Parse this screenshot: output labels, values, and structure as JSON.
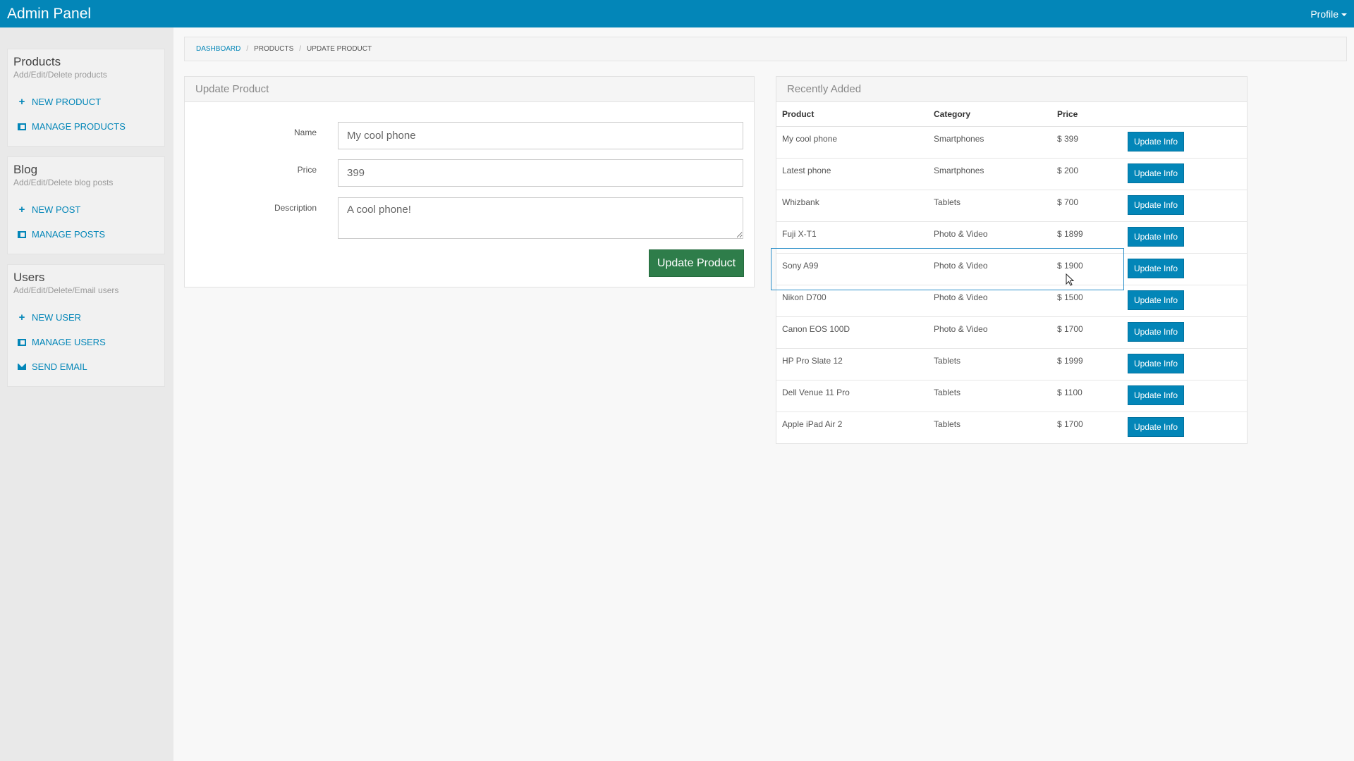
{
  "app": {
    "title": "Admin Panel",
    "profile_label": "Profile"
  },
  "sidebar": {
    "groups": [
      {
        "title": "Products",
        "subtitle": "Add/Edit/Delete products",
        "links": [
          {
            "label": "NEW PRODUCT",
            "icon": "plus-icon"
          },
          {
            "label": "MANAGE PRODUCTS",
            "icon": "list-icon"
          }
        ]
      },
      {
        "title": "Blog",
        "subtitle": "Add/Edit/Delete blog posts",
        "links": [
          {
            "label": "NEW POST",
            "icon": "plus-icon"
          },
          {
            "label": "MANAGE POSTS",
            "icon": "list-icon"
          }
        ]
      },
      {
        "title": "Users",
        "subtitle": "Add/Edit/Delete/Email users",
        "links": [
          {
            "label": "NEW USER",
            "icon": "plus-icon"
          },
          {
            "label": "MANAGE USERS",
            "icon": "list-icon"
          },
          {
            "label": "SEND EMAIL",
            "icon": "envelope-icon"
          }
        ]
      }
    ]
  },
  "breadcrumb": {
    "items": [
      "DASHBOARD",
      "PRODUCTS",
      "UPDATE PRODUCT"
    ],
    "separator": "/"
  },
  "update_form": {
    "title": "Update Product",
    "name_label": "Name",
    "name_value": "My cool phone",
    "price_label": "Price",
    "price_value": "399",
    "description_label": "Description",
    "description_value": "A cool phone!",
    "submit_label": "Update Product"
  },
  "recent": {
    "title": "Recently Added",
    "columns": [
      "Product",
      "Category",
      "Price"
    ],
    "action_label": "Update Info",
    "rows": [
      {
        "product": "My cool phone",
        "category": "Smartphones",
        "price": "$ 399"
      },
      {
        "product": "Latest phone",
        "category": "Smartphones",
        "price": "$ 200"
      },
      {
        "product": "Whizbank",
        "category": "Tablets",
        "price": "$ 700"
      },
      {
        "product": "Fuji X-T1",
        "category": "Photo & Video",
        "price": "$ 1899"
      },
      {
        "product": "Sony A99",
        "category": "Photo & Video",
        "price": "$ 1900"
      },
      {
        "product": "Nikon D700",
        "category": "Photo & Video",
        "price": "$ 1500"
      },
      {
        "product": "Canon EOS 100D",
        "category": "Photo & Video",
        "price": "$ 1700"
      },
      {
        "product": "HP Pro Slate 12",
        "category": "Tablets",
        "price": "$ 1999"
      },
      {
        "product": "Dell Venue 11 Pro",
        "category": "Tablets",
        "price": "$ 1100"
      },
      {
        "product": "Apple iPad Air 2",
        "category": "Tablets",
        "price": "$ 1700"
      }
    ]
  },
  "colors": {
    "accent": "#0386b8",
    "success": "#2e7d4a"
  }
}
